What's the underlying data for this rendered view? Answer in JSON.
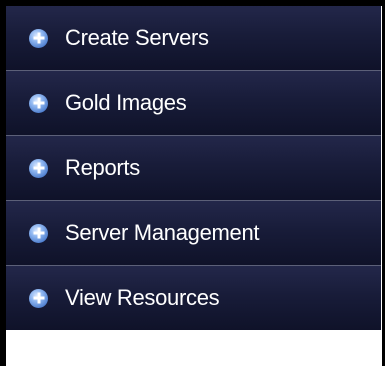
{
  "menu": {
    "items": [
      {
        "label": "Create Servers",
        "icon": "plus-circle-icon"
      },
      {
        "label": "Gold Images",
        "icon": "plus-circle-icon"
      },
      {
        "label": "Reports",
        "icon": "plus-circle-icon"
      },
      {
        "label": "Server Management",
        "icon": "plus-circle-icon"
      },
      {
        "label": "View Resources",
        "icon": "plus-circle-icon"
      }
    ]
  }
}
